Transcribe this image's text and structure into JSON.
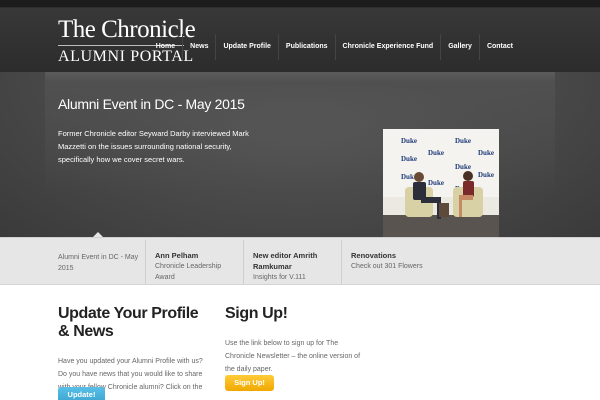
{
  "logo": {
    "title": "The Chronicle",
    "subtitle": "ALUMNI PORTAL"
  },
  "nav": {
    "items": [
      "Home",
      "News",
      "Update Profile",
      "Publications",
      "Chronicle Experience Fund",
      "Gallery",
      "Contact"
    ]
  },
  "hero": {
    "title": "Alumni Event in DC - May 2015",
    "text": "Former Chronicle editor Seyward Darby interviewed Mark Mazzetti on the issues surrounding national security, specifically how we cover secret wars.",
    "photo_banner": "Duke"
  },
  "slider": {
    "items": [
      {
        "title": "",
        "subtitle": "Alumni Event in DC - May 2015"
      },
      {
        "title": "Ann Pelham",
        "subtitle": "Chronicle Leadership Award"
      },
      {
        "title": "New editor Amrith Ramkumar",
        "subtitle": "Insights for V.111"
      },
      {
        "title": "Renovations",
        "subtitle": "Check out 301 Flowers"
      }
    ]
  },
  "profile": {
    "title": "Update Your Profile & News",
    "text": "Have you updated your Alumni Profile with us? Do you have news that you would like to share with your fellow Chronicle alumni? Click on the button below.",
    "button": "Update!"
  },
  "signup": {
    "title": "Sign Up!",
    "text": "Use the link below to sign up for The Chronicle Newsletter – the online version of the daily paper.",
    "button": "Sign Up!"
  },
  "colors": {
    "header": "#333333",
    "hero": "#4d4d4d",
    "update_button": "#4ab3dc",
    "signup_button": "#f7b919"
  }
}
